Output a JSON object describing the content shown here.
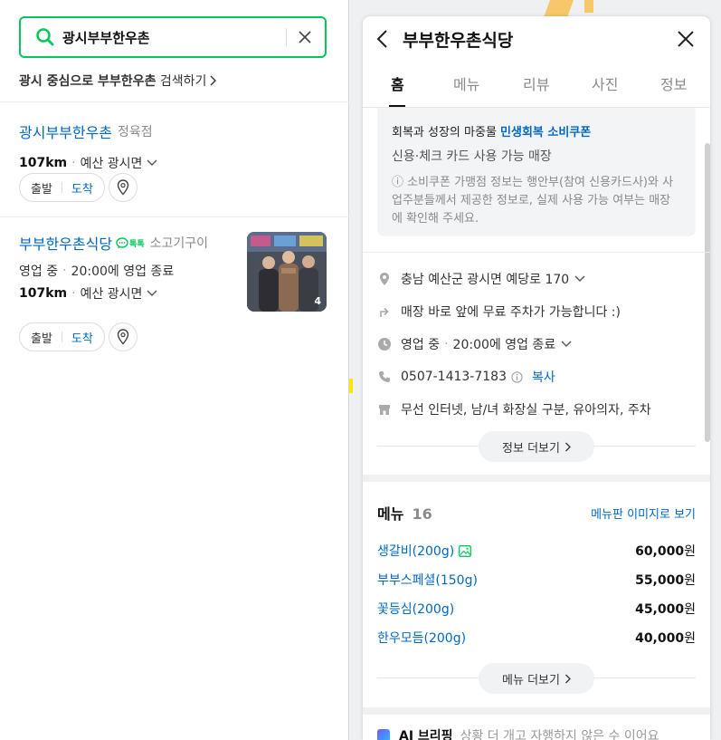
{
  "search": {
    "query": "광시부부한우촌",
    "suggest_bold_1": "광시",
    "suggest_mid": " 중심으로 ",
    "suggest_bold_2": "부부한우촌",
    "suggest_tail": " 검색하기"
  },
  "results": [
    {
      "name": "광시부부한우촌",
      "category": "정육점",
      "distance": "107km",
      "area": "예산 광시면",
      "start_label": "출발",
      "arrive_label": "도착"
    },
    {
      "name": "부부한우촌식당",
      "talk_label": "톡톡",
      "category": "소고기구이",
      "status": "영업 중",
      "hours": "20:00에 영업 종료",
      "distance": "107km",
      "area": "예산 광시면",
      "photo_count": "4",
      "start_label": "출발",
      "arrive_label": "도착"
    }
  ],
  "detail": {
    "title": "부부한우촌식당",
    "tabs": [
      "홈",
      "메뉴",
      "리뷰",
      "사진",
      "정보"
    ],
    "active_tab": "홈",
    "coupon": {
      "title_plain": "회복과 성장의 마중물 ",
      "title_highlight": "민생회복 소비쿠폰",
      "subtitle": "신용·체크 카드 사용 가능 매장",
      "note": "ⓘ 소비쿠폰 가맹점 정보는 행안부(참여 신용카드사)와 사업주분들께서 제공한 정보로, 실제 사용 가능 여부는 매장에 확인해 주세요."
    },
    "info": {
      "address": "충남 예산군 광시면 예당로 170",
      "parking": "매장 바로 앞에 무료 주차가 가능합니다 :)",
      "status": "영업 중",
      "hours": "20:00에 영업 종료",
      "phone": "0507-1413-7183",
      "copy_label": "복사",
      "amenities": "무선 인터넷, 남/녀 화장실 구분, 유아의자, 주차"
    },
    "info_more_label": "정보 더보기",
    "menu": {
      "heading": "메뉴",
      "count": "16",
      "image_link": "메뉴판 이미지로 보기",
      "items": [
        {
          "name": "생갈비(200g)",
          "price": "60,000",
          "won": "원"
        },
        {
          "name": "부부스페셜(150g)",
          "price": "55,000",
          "won": "원"
        },
        {
          "name": "꽃등심(200g)",
          "price": "45,000",
          "won": "원"
        },
        {
          "name": "한우모듬(200g)",
          "price": "40,000",
          "won": "원"
        }
      ],
      "more_label": "메뉴 더보기"
    },
    "ai_title": "AI 브리핑",
    "ai_text": "상황 더 개고 자행하지 않은 수 이어요"
  },
  "colors": {
    "naver_green": "#03c75a",
    "link_blue": "#0068c3"
  }
}
